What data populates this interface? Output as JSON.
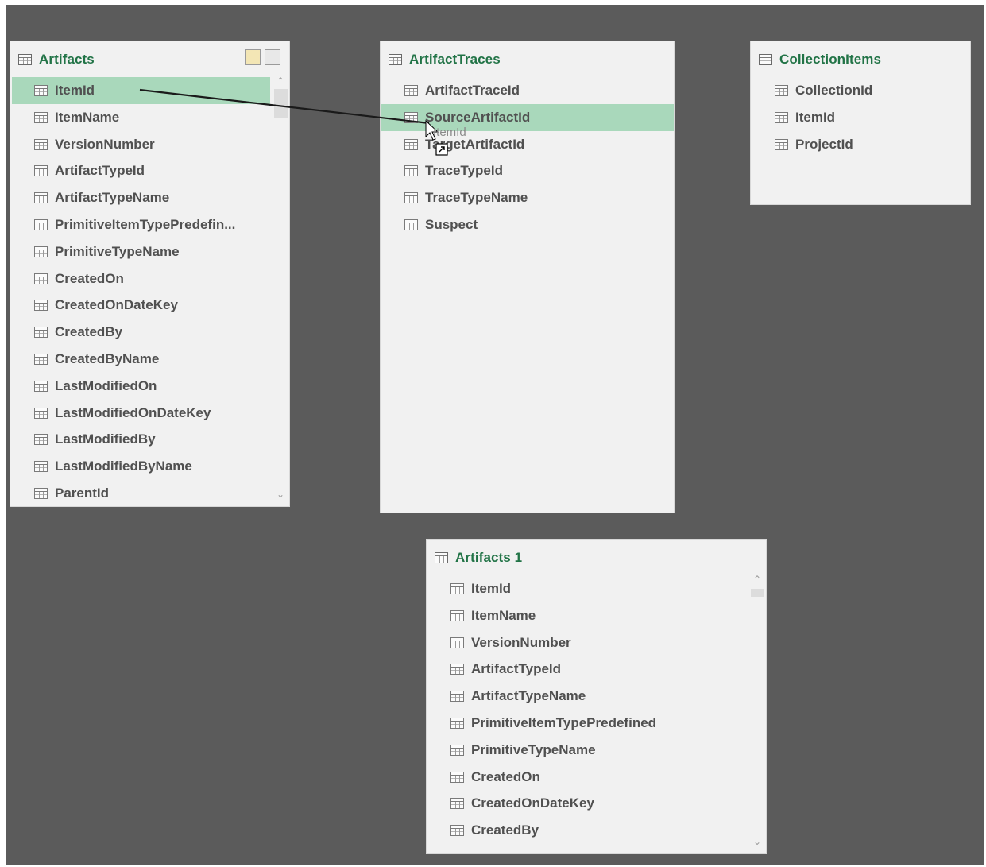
{
  "tables": {
    "artifacts": {
      "title": "Artifacts",
      "fields": [
        "ItemId",
        "ItemName",
        "VersionNumber",
        "ArtifactTypeId",
        "ArtifactTypeName",
        "PrimitiveItemTypePredefin...",
        "PrimitiveTypeName",
        "CreatedOn",
        "CreatedOnDateKey",
        "CreatedBy",
        "CreatedByName",
        "LastModifiedOn",
        "LastModifiedOnDateKey",
        "LastModifiedBy",
        "LastModifiedByName",
        "ParentId"
      ],
      "selected_field": "ItemId"
    },
    "artifact_traces": {
      "title": "ArtifactTraces",
      "fields": [
        "ArtifactTraceId",
        "SourceArtifactId",
        "TargetArtifactId",
        "TraceTypeId",
        "TraceTypeName",
        "Suspect"
      ],
      "selected_field": "SourceArtifactId"
    },
    "collection_items": {
      "title": "CollectionItems",
      "fields": [
        "CollectionId",
        "ItemId",
        "ProjectId"
      ]
    },
    "artifacts_1": {
      "title": "Artifacts 1",
      "fields": [
        "ItemId",
        "ItemName",
        "VersionNumber",
        "ArtifactTypeId",
        "ArtifactTypeName",
        "PrimitiveItemTypePredefined",
        "PrimitiveTypeName",
        "CreatedOn",
        "CreatedOnDateKey",
        "CreatedBy"
      ]
    }
  },
  "drag": {
    "label": "ItemId"
  },
  "colors": {
    "canvas": "#5b5b5b",
    "card": "#f1f1f1",
    "title": "#217346",
    "selected_row": "#a9d8bb",
    "field_text": "#505050"
  }
}
